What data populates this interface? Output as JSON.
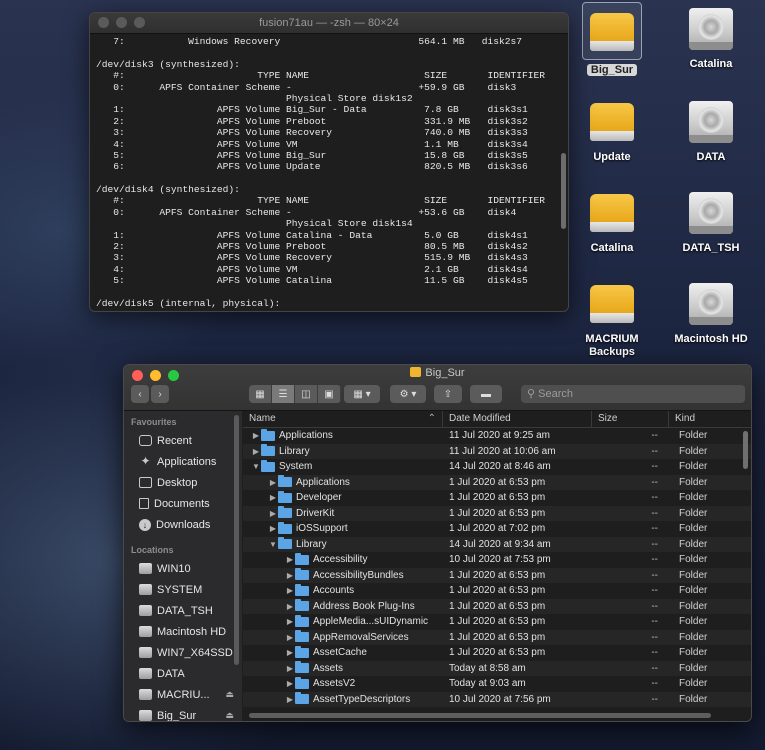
{
  "terminal": {
    "title": "fusion71au — -zsh — 80×24",
    "lines": [
      "   7:           Windows Recovery                        564.1 MB   disk2s7",
      "",
      "/dev/disk3 (synthesized):",
      "   #:                       TYPE NAME                    SIZE       IDENTIFIER",
      "   0:      APFS Container Scheme -                      +59.9 GB    disk3",
      "                                 Physical Store disk1s2",
      "   1:                APFS Volume Big_Sur - Data          7.8 GB     disk3s1",
      "   2:                APFS Volume Preboot                 331.9 MB   disk3s2",
      "   3:                APFS Volume Recovery                740.0 MB   disk3s3",
      "   4:                APFS Volume VM                      1.1 MB     disk3s4",
      "   5:                APFS Volume Big_Sur                 15.8 GB    disk3s5",
      "   6:                APFS Volume Update                  820.5 MB   disk3s6",
      "",
      "/dev/disk4 (synthesized):",
      "   #:                       TYPE NAME                    SIZE       IDENTIFIER",
      "   0:      APFS Container Scheme -                      +53.6 GB    disk4",
      "                                 Physical Store disk1s4",
      "   1:                APFS Volume Catalina - Data         5.0 GB     disk4s1",
      "   2:                APFS Volume Preboot                 80.5 MB    disk4s2",
      "   3:                APFS Volume Recovery                515.9 MB   disk4s3",
      "   4:                APFS Volume VM                      2.1 GB     disk4s4",
      "   5:                APFS Volume Catalina                11.5 GB    disk4s5",
      "",
      "/dev/disk5 (internal, physical):"
    ]
  },
  "desktop": {
    "icons": [
      {
        "label": "Big_Sur",
        "kind": "yellow",
        "selected": true
      },
      {
        "label": "Catalina",
        "kind": "gray"
      },
      {
        "label": "Update",
        "kind": "yellow"
      },
      {
        "label": "DATA",
        "kind": "gray"
      },
      {
        "label": "Catalina",
        "kind": "yellow"
      },
      {
        "label": "DATA_TSH",
        "kind": "gray"
      },
      {
        "label": "MACRIUM Backups",
        "kind": "yellow"
      },
      {
        "label": "Macintosh HD",
        "kind": "gray"
      }
    ]
  },
  "finder": {
    "title": "Big_Sur",
    "search_placeholder": "Search",
    "sidebar": {
      "favourites_heading": "Favourites",
      "favourites": [
        {
          "label": "Recent",
          "icon": "clock-icon"
        },
        {
          "label": "Applications",
          "icon": "apps-icon"
        },
        {
          "label": "Desktop",
          "icon": "desktop-icon"
        },
        {
          "label": "Documents",
          "icon": "document-icon"
        },
        {
          "label": "Downloads",
          "icon": "download-icon"
        }
      ],
      "locations_heading": "Locations",
      "locations": [
        {
          "label": "WIN10",
          "eject": false
        },
        {
          "label": "SYSTEM",
          "eject": false
        },
        {
          "label": "DATA_TSH",
          "eject": false
        },
        {
          "label": "Macintosh HD",
          "eject": false
        },
        {
          "label": "WIN7_X64SSD",
          "eject": false
        },
        {
          "label": "DATA",
          "eject": false
        },
        {
          "label": "MACRIU...",
          "eject": true
        },
        {
          "label": "Big_Sur",
          "eject": true
        }
      ]
    },
    "columns": {
      "name": "Name",
      "date": "Date Modified",
      "size": "Size",
      "kind": "Kind"
    },
    "rows": [
      {
        "level": 0,
        "open": false,
        "name": "Applications",
        "date": "11 Jul 2020 at 9:25 am",
        "size": "--",
        "kind": "Folder"
      },
      {
        "level": 0,
        "open": false,
        "name": "Library",
        "date": "11 Jul 2020 at 10:06 am",
        "size": "--",
        "kind": "Folder"
      },
      {
        "level": 0,
        "open": true,
        "name": "System",
        "date": "14 Jul 2020 at 8:46 am",
        "size": "--",
        "kind": "Folder"
      },
      {
        "level": 1,
        "open": false,
        "name": "Applications",
        "date": "1 Jul 2020 at 6:53 pm",
        "size": "--",
        "kind": "Folder"
      },
      {
        "level": 1,
        "open": false,
        "name": "Developer",
        "date": "1 Jul 2020 at 6:53 pm",
        "size": "--",
        "kind": "Folder"
      },
      {
        "level": 1,
        "open": false,
        "name": "DriverKit",
        "date": "1 Jul 2020 at 6:53 pm",
        "size": "--",
        "kind": "Folder"
      },
      {
        "level": 1,
        "open": false,
        "name": "iOSSupport",
        "date": "1 Jul 2020 at 7:02 pm",
        "size": "--",
        "kind": "Folder"
      },
      {
        "level": 1,
        "open": true,
        "name": "Library",
        "date": "14 Jul 2020 at 9:34 am",
        "size": "--",
        "kind": "Folder"
      },
      {
        "level": 2,
        "open": false,
        "name": "Accessibility",
        "date": "10 Jul 2020 at 7:53 pm",
        "size": "--",
        "kind": "Folder"
      },
      {
        "level": 2,
        "open": false,
        "name": "AccessibilityBundles",
        "date": "1 Jul 2020 at 6:53 pm",
        "size": "--",
        "kind": "Folder"
      },
      {
        "level": 2,
        "open": false,
        "name": "Accounts",
        "date": "1 Jul 2020 at 6:53 pm",
        "size": "--",
        "kind": "Folder"
      },
      {
        "level": 2,
        "open": false,
        "name": "Address Book Plug-Ins",
        "date": "1 Jul 2020 at 6:53 pm",
        "size": "--",
        "kind": "Folder"
      },
      {
        "level": 2,
        "open": false,
        "name": "AppleMedia...sUIDynamic",
        "date": "1 Jul 2020 at 6:53 pm",
        "size": "--",
        "kind": "Folder"
      },
      {
        "level": 2,
        "open": false,
        "name": "AppRemovalServices",
        "date": "1 Jul 2020 at 6:53 pm",
        "size": "--",
        "kind": "Folder"
      },
      {
        "level": 2,
        "open": false,
        "name": "AssetCache",
        "date": "1 Jul 2020 at 6:53 pm",
        "size": "--",
        "kind": "Folder"
      },
      {
        "level": 2,
        "open": false,
        "name": "Assets",
        "date": "Today at 8:58 am",
        "size": "--",
        "kind": "Folder"
      },
      {
        "level": 2,
        "open": false,
        "name": "AssetsV2",
        "date": "Today at 9:03 am",
        "size": "--",
        "kind": "Folder"
      },
      {
        "level": 2,
        "open": false,
        "name": "AssetTypeDescriptors",
        "date": "10 Jul 2020 at 7:56 pm",
        "size": "--",
        "kind": "Folder"
      }
    ]
  }
}
